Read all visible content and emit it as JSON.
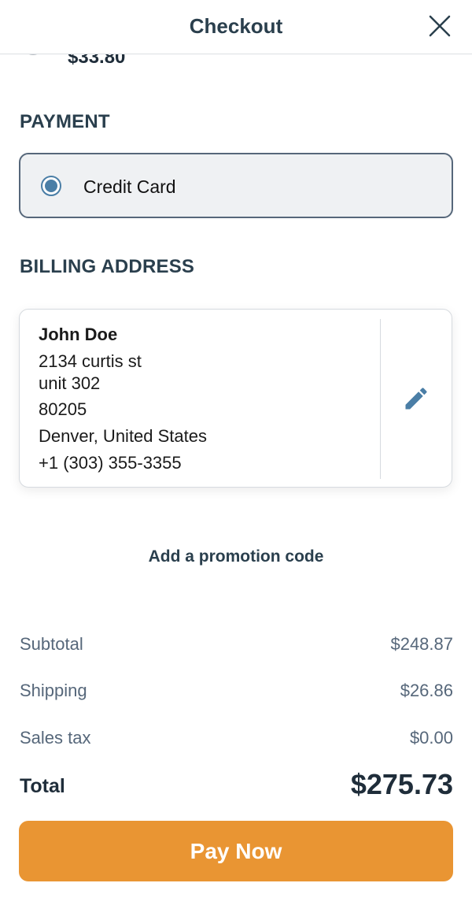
{
  "header": {
    "title": "Checkout",
    "close_icon": "close-icon"
  },
  "shipping": {
    "partial_price": "$33.80"
  },
  "payment": {
    "heading": "PAYMENT",
    "option_label": "Credit Card",
    "selected": true,
    "accent_color": "#4a7ea6"
  },
  "billing": {
    "heading": "BILLING ADDRESS",
    "name": "John Doe",
    "lines": [
      "2134 curtis st",
      "unit 302",
      "80205",
      "Denver, United States",
      "+1 (303) 355-3355"
    ],
    "edit_icon": "pencil-icon"
  },
  "promo": {
    "label": "Add a promotion code"
  },
  "summary": {
    "subtotal_label": "Subtotal",
    "subtotal": "$248.87",
    "shipping_label": "Shipping",
    "shipping": "$26.86",
    "tax_label": "Sales tax",
    "tax": "$0.00",
    "total_label": "Total",
    "total": "$275.73"
  },
  "pay_button": {
    "label": "Pay Now",
    "color": "#e99533"
  }
}
